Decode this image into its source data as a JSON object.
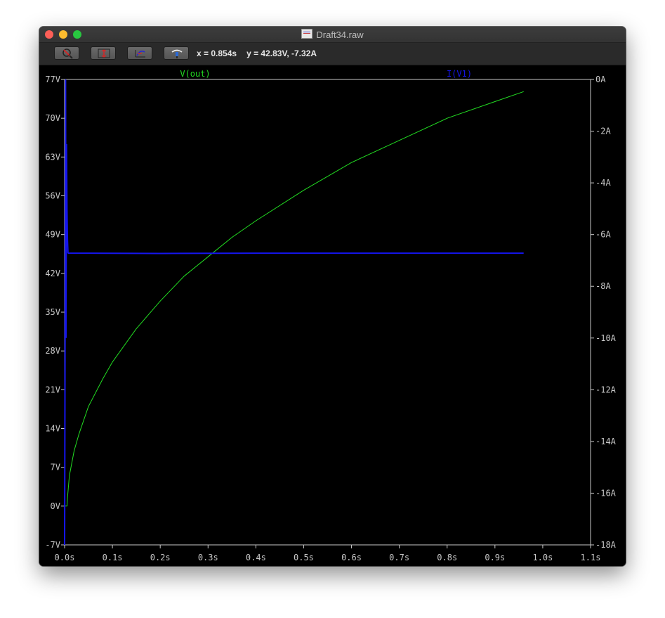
{
  "window": {
    "title": "Draft34.raw"
  },
  "toolbar": {
    "buttons": [
      {
        "name": "zoom-fit-button",
        "icon": "zoom-cancel-icon"
      },
      {
        "name": "autorange-y-button",
        "icon": "autorange-icon"
      },
      {
        "name": "pan-button",
        "icon": "pan-icon"
      },
      {
        "name": "probe-button",
        "icon": "probe-icon"
      }
    ],
    "cursor_x": "x = 0.854s",
    "cursor_y": "y = 42.83V, -7.32A"
  },
  "chart_data": {
    "type": "line",
    "xlabel": "",
    "x_ticks": [
      "0.0s",
      "0.1s",
      "0.2s",
      "0.3s",
      "0.4s",
      "0.5s",
      "0.6s",
      "0.7s",
      "0.8s",
      "0.9s",
      "1.0s",
      "1.1s"
    ],
    "xlim": [
      0.0,
      1.1
    ],
    "left_axis": {
      "ticks": [
        "77V",
        "70V",
        "63V",
        "56V",
        "49V",
        "42V",
        "35V",
        "28V",
        "21V",
        "14V",
        "7V",
        "0V",
        "-7V"
      ],
      "ylim": [
        -7,
        77
      ]
    },
    "right_axis": {
      "ticks": [
        "0A",
        "-2A",
        "-4A",
        "-6A",
        "-8A",
        "-10A",
        "-12A",
        "-14A",
        "-16A",
        "-18A"
      ],
      "ylim": [
        -18,
        0
      ]
    },
    "grid": false,
    "legend": "top",
    "colors": {
      "green": "#22dd22",
      "blue": "#1515ee",
      "axis": "#c8c8c8",
      "background": "#000000"
    },
    "series": [
      {
        "name": "V(out)",
        "axis": "left",
        "color": "#22dd22",
        "x": [
          0.0,
          0.005,
          0.006,
          0.01,
          0.02,
          0.03,
          0.05,
          0.08,
          0.1,
          0.15,
          0.2,
          0.25,
          0.3,
          0.35,
          0.4,
          0.5,
          0.6,
          0.7,
          0.8,
          0.9,
          0.96
        ],
        "y": [
          0.0,
          0.0,
          1.5,
          5.5,
          10.0,
          13.0,
          18.0,
          23.0,
          26.0,
          32.0,
          37.0,
          41.5,
          45.0,
          48.5,
          51.5,
          57.0,
          62.0,
          66.0,
          70.0,
          73.0,
          74.8
        ]
      },
      {
        "name": "I(V1)",
        "axis": "right",
        "color": "#1515ee",
        "x": [
          0.0,
          0.001,
          0.002,
          0.003,
          0.004,
          0.005,
          0.006,
          0.007,
          0.008,
          0.01,
          0.05,
          0.2,
          0.4,
          0.6,
          0.8,
          0.96
        ],
        "y": [
          -18.0,
          -10.0,
          0.0,
          -10.0,
          -2.5,
          -5.0,
          -6.2,
          -6.7,
          -6.72,
          -6.72,
          -6.72,
          -6.73,
          -6.72,
          -6.72,
          -6.72,
          -6.72
        ]
      }
    ]
  }
}
